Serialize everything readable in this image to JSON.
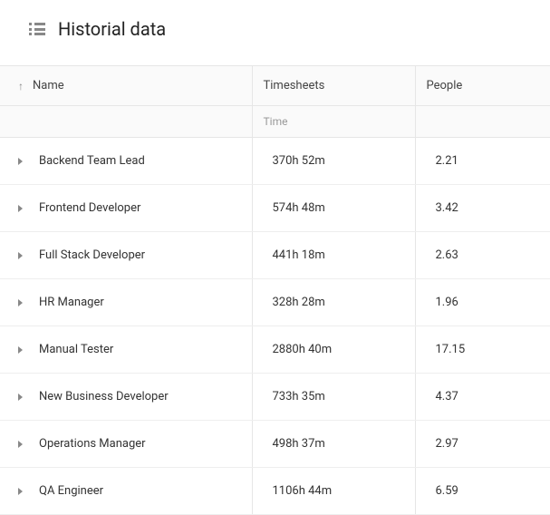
{
  "header": {
    "title": "Historial data"
  },
  "table": {
    "columns": {
      "name": "Name",
      "timesheets": "Timesheets",
      "people": "People"
    },
    "subheader": {
      "time": "Time"
    },
    "rows": [
      {
        "name": "Backend Team Lead",
        "time": "370h 52m",
        "people": "2.21"
      },
      {
        "name": "Frontend Developer",
        "time": "574h 48m",
        "people": "3.42"
      },
      {
        "name": "Full Stack Developer",
        "time": "441h 18m",
        "people": "2.63"
      },
      {
        "name": "HR Manager",
        "time": "328h 28m",
        "people": "1.96"
      },
      {
        "name": "Manual Tester",
        "time": "2880h 40m",
        "people": "17.15"
      },
      {
        "name": "New Business Developer",
        "time": "733h 35m",
        "people": "4.37"
      },
      {
        "name": "Operations Manager",
        "time": "498h 37m",
        "people": "2.97"
      },
      {
        "name": "QA Engineer",
        "time": "1106h 44m",
        "people": "6.59"
      }
    ]
  }
}
